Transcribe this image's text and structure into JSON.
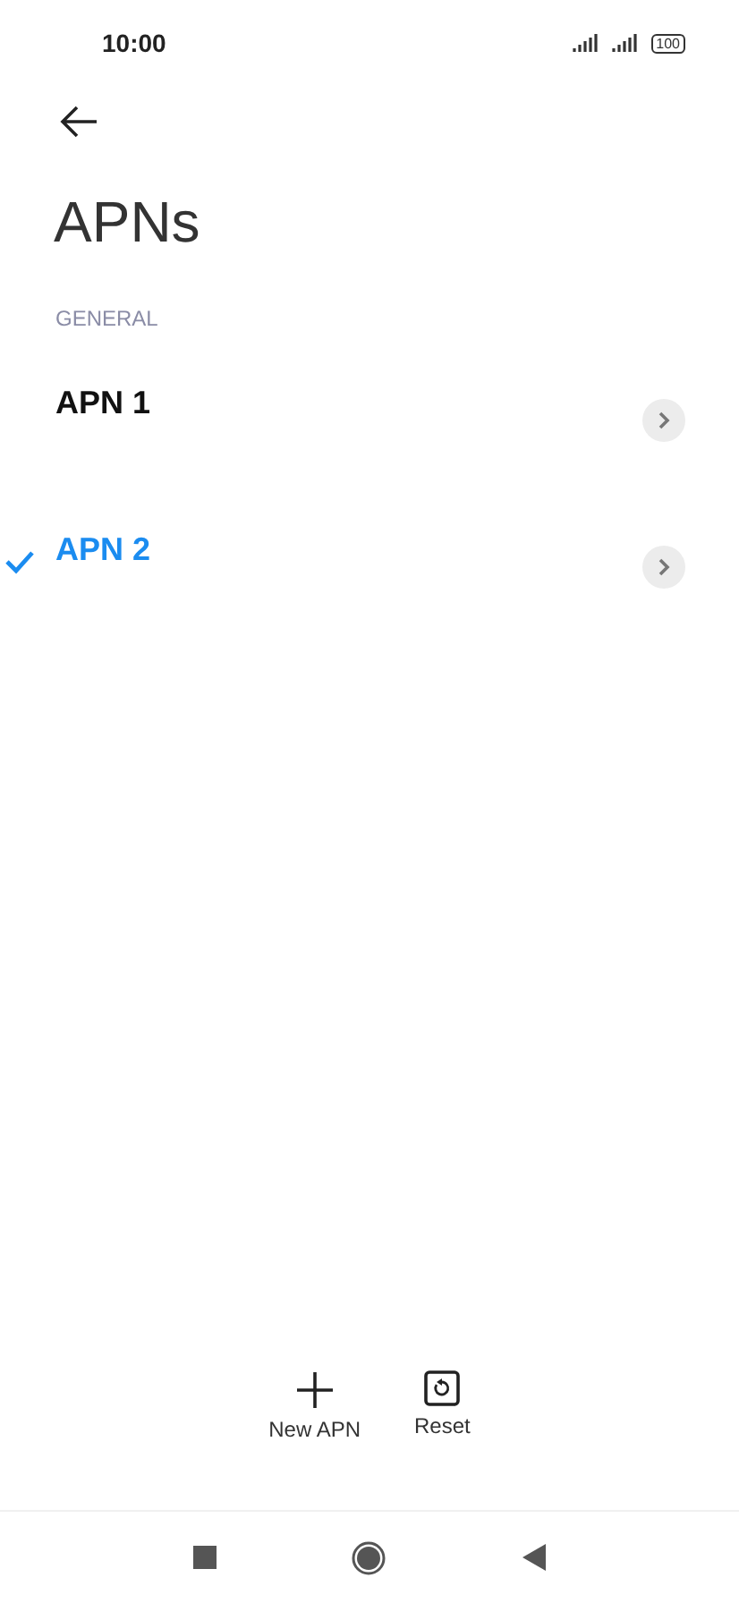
{
  "status_bar": {
    "time": "10:00",
    "battery": "100"
  },
  "title": "APNs",
  "section": "GENERAL",
  "apns": [
    {
      "name": "APN 1",
      "selected": false
    },
    {
      "name": "APN 2",
      "selected": true
    }
  ],
  "actions": [
    {
      "kind": "add",
      "label": "New APN"
    },
    {
      "kind": "reset",
      "label": "Reset"
    }
  ]
}
